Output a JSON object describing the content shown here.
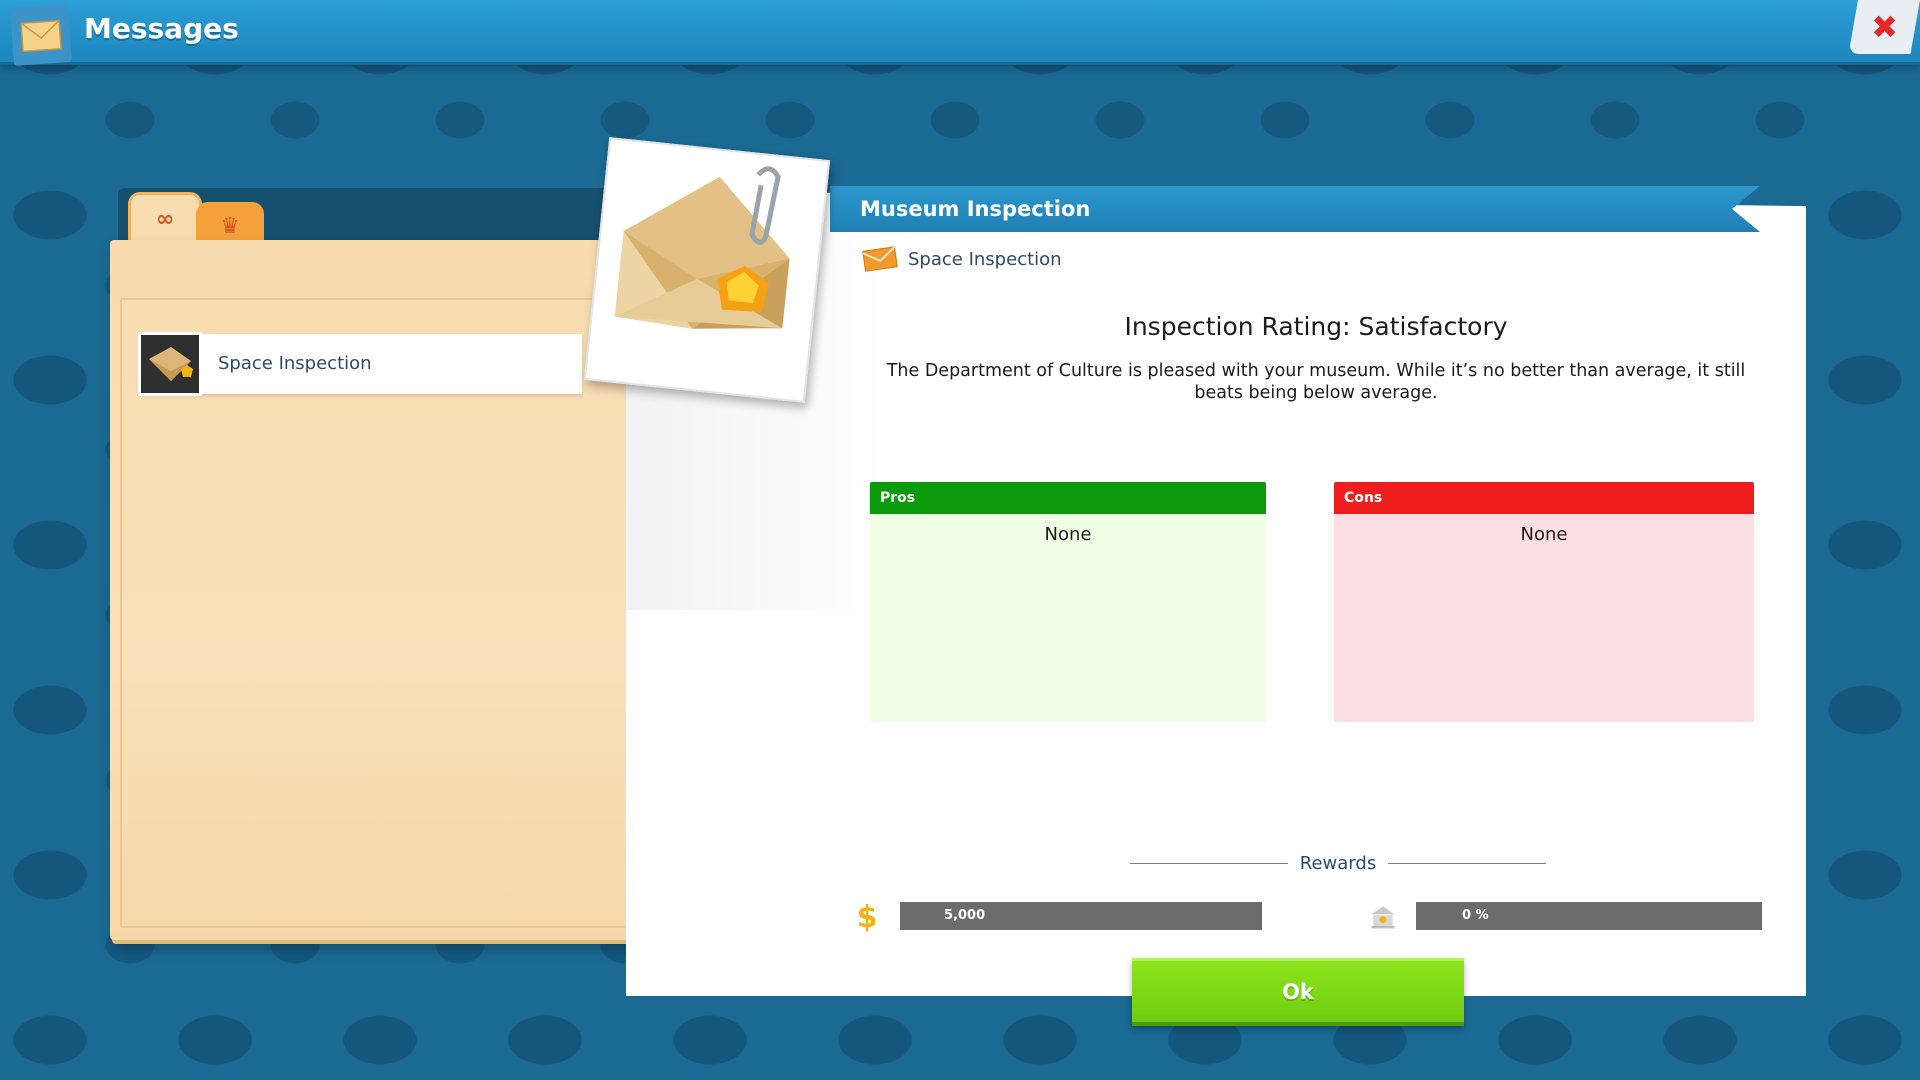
{
  "window": {
    "title": "Messages",
    "icon": "envelope-icon",
    "close_icon": "close-icon",
    "close_symbol": "✖"
  },
  "folder": {
    "tabs": [
      {
        "icon": "infinity-icon",
        "symbol": "∞",
        "active": true
      },
      {
        "icon": "crown-icon",
        "symbol": "♛",
        "active": false
      }
    ],
    "messages": [
      {
        "label": "Space Inspection",
        "icon": "envelope-badge-icon"
      }
    ]
  },
  "message": {
    "header": "Museum Inspection",
    "subject_icon": "envelope-icon",
    "subject": "Space Inspection",
    "rating_title": "Inspection Rating: Satisfactory",
    "description": "The Department of Culture is pleased with your museum. While it’s no better than average, it still beats being below average.",
    "pros": {
      "title": "Pros",
      "content": "None"
    },
    "cons": {
      "title": "Cons",
      "content": "None"
    }
  },
  "rewards": {
    "label": "Rewards",
    "money": {
      "icon": "money-icon",
      "symbol": "$",
      "value": "5,000"
    },
    "reputation": {
      "icon": "reputation-icon",
      "value": "0 %"
    }
  },
  "ok_button": {
    "label": "Ok"
  },
  "colors": {
    "accent": "#1f86bd",
    "pros": "#0b9a0b",
    "cons": "#ee1e1e",
    "ok": "#7dd816"
  }
}
